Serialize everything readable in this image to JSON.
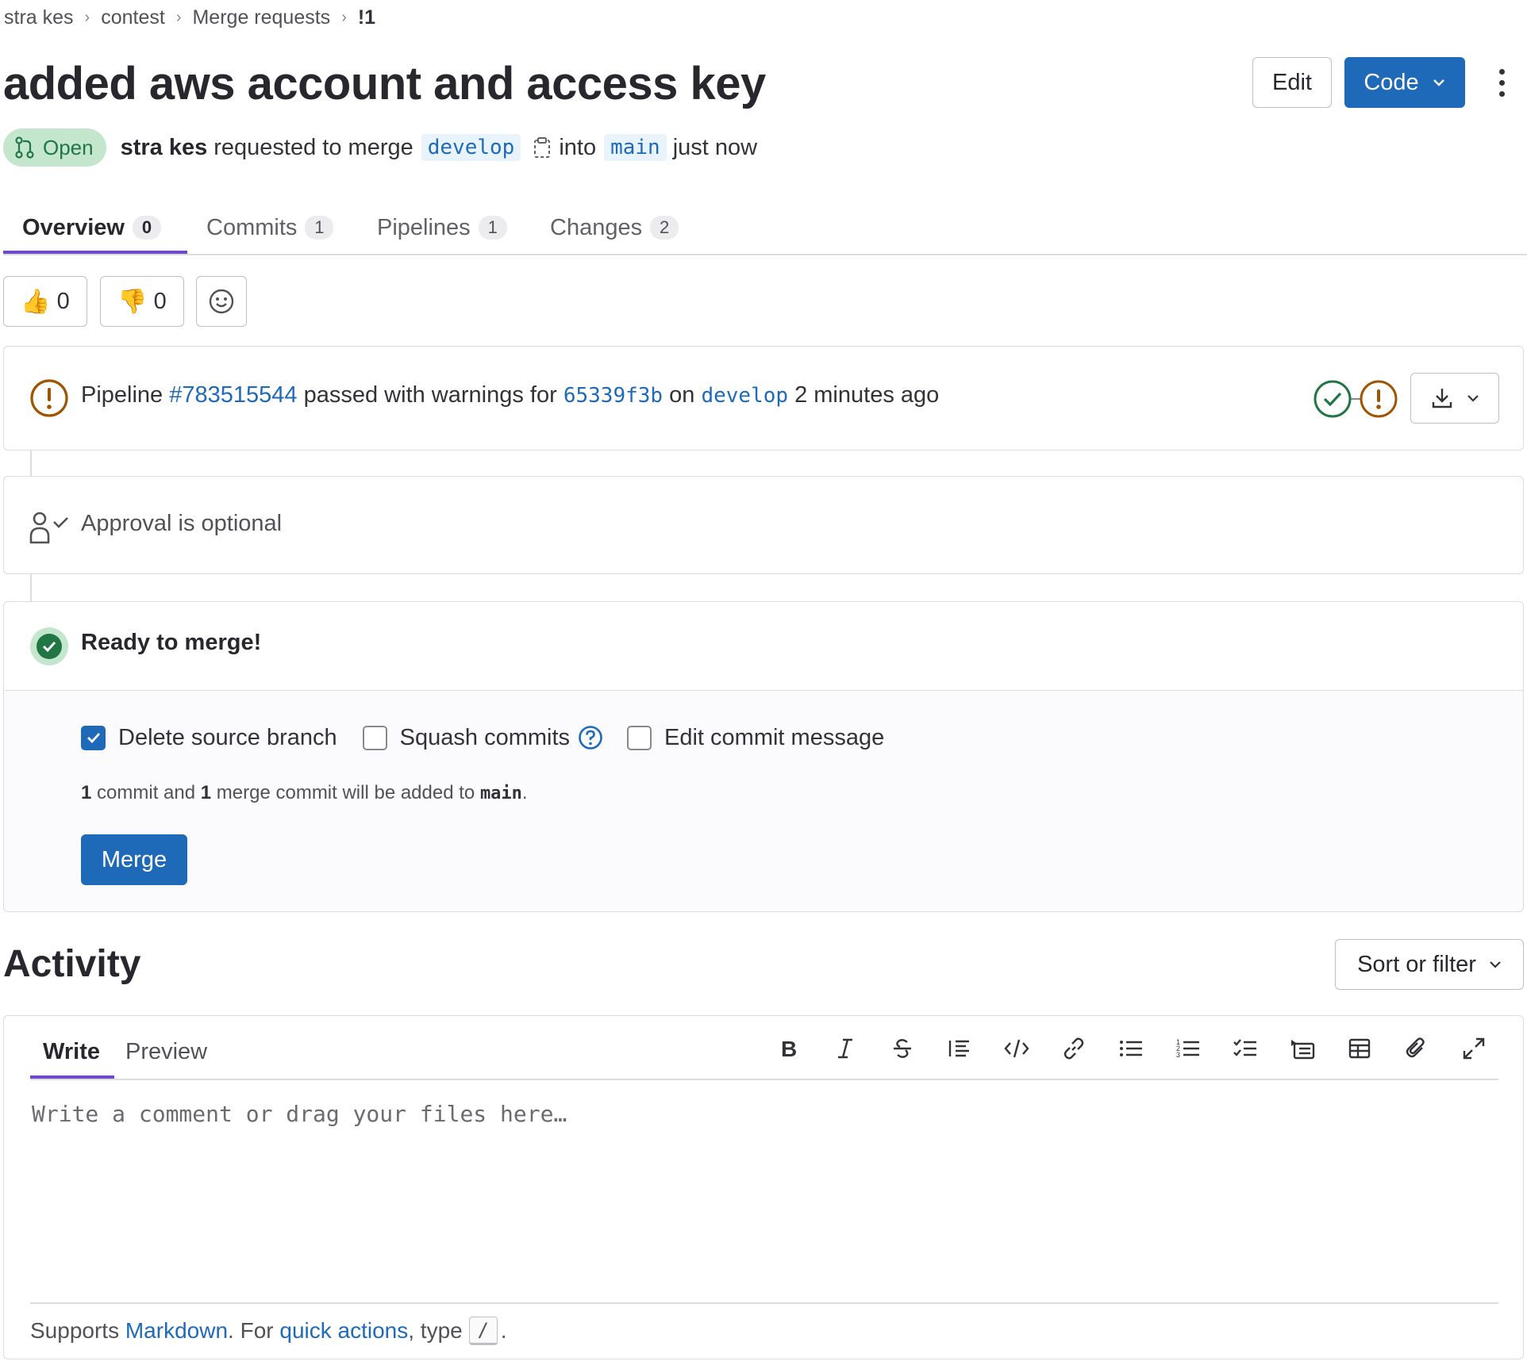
{
  "breadcrumb": {
    "items": [
      "stra kes",
      "contest",
      "Merge requests"
    ],
    "current": "!1"
  },
  "mr": {
    "title": "added aws account and access key",
    "status": "Open",
    "author": "stra kes",
    "requested_text": "requested to merge",
    "source_branch": "develop",
    "into_text": "into",
    "target_branch": "main",
    "time": "just now"
  },
  "header_actions": {
    "edit_label": "Edit",
    "code_label": "Code"
  },
  "tabs": [
    {
      "label": "Overview",
      "count": "0"
    },
    {
      "label": "Commits",
      "count": "1"
    },
    {
      "label": "Pipelines",
      "count": "1"
    },
    {
      "label": "Changes",
      "count": "2"
    }
  ],
  "reactions": {
    "thumbs_up": "0",
    "thumbs_down": "0"
  },
  "pipeline": {
    "prefix": "Pipeline",
    "id": "#783515544",
    "status_text": "passed with warnings for",
    "commit": "65339f3b",
    "on_text": "on",
    "branch": "develop",
    "time": "2 minutes ago"
  },
  "approval": {
    "text": "Approval is optional"
  },
  "merge": {
    "ready_text": "Ready to merge!",
    "delete_source_label": "Delete source branch",
    "squash_label": "Squash commits",
    "edit_message_label": "Edit commit message",
    "summary": {
      "commit_count": "1",
      "commit_text": "commit and",
      "merge_count": "1",
      "merge_text": "merge commit will be added to",
      "branch": "main",
      "end": "."
    },
    "button_label": "Merge"
  },
  "activity": {
    "title": "Activity",
    "sort_label": "Sort or filter"
  },
  "editor": {
    "write_tab": "Write",
    "preview_tab": "Preview",
    "placeholder": "Write a comment or drag your files here…",
    "footer_prefix": "Supports",
    "markdown_link": "Markdown",
    "footer_middle": ". For",
    "quick_actions_link": "quick actions",
    "footer_type": ", type",
    "kbd": "/",
    "footer_end": "."
  },
  "colors": {
    "brand_blue": "#1f6ab8",
    "tab_underline": "#6e49cb",
    "open_badge_bg": "#c3e6cd",
    "success_green": "#217645",
    "warning_orange": "#9e5400"
  }
}
